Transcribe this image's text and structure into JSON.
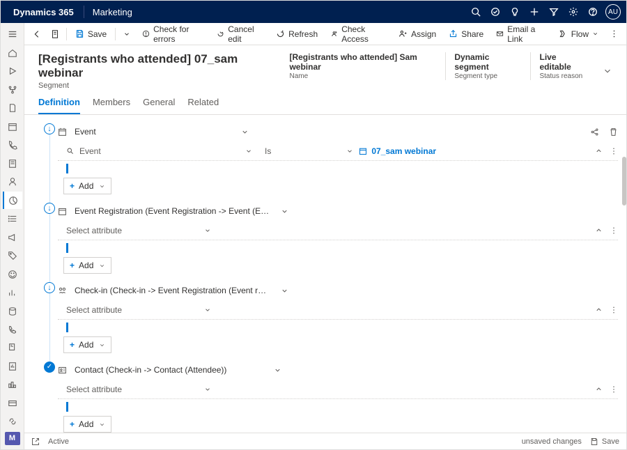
{
  "header": {
    "brand": "Dynamics 365",
    "module": "Marketing",
    "avatar": "AU"
  },
  "cmdbar": {
    "save": "Save",
    "check_errors": "Check for errors",
    "cancel_edit": "Cancel edit",
    "refresh": "Refresh",
    "check_access": "Check Access",
    "assign": "Assign",
    "share": "Share",
    "email_link": "Email a Link",
    "flow": "Flow"
  },
  "record": {
    "title": "[Registrants who attended] 07_sam webinar",
    "subtitle": "Segment",
    "meta": [
      {
        "value": "[Registrants who attended] Sam webinar",
        "label": "Name"
      },
      {
        "value": "Dynamic segment",
        "label": "Segment type"
      },
      {
        "value": "Live editable",
        "label": "Status reason"
      }
    ]
  },
  "tabs": [
    "Definition",
    "Members",
    "General",
    "Related"
  ],
  "blocks": [
    {
      "entity": "Event",
      "icon": "calendar",
      "attribute": "Event",
      "operator": "Is",
      "value": "07_sam webinar",
      "has_attr": true,
      "dot": "arrow"
    },
    {
      "entity": "Event Registration (Event Registration -> Event (Eve...",
      "icon": "calendar",
      "placeholder": "Select attribute",
      "has_attr": false,
      "dot": "arrow"
    },
    {
      "entity": "Check-in (Check-in -> Event Registration (Event reg...",
      "icon": "checkin",
      "placeholder": "Select attribute",
      "has_attr": false,
      "dot": "arrow"
    },
    {
      "entity": "Contact (Check-in -> Contact (Attendee))",
      "icon": "contact",
      "placeholder": "Select attribute",
      "has_attr": false,
      "dot": "check"
    }
  ],
  "add_label": "Add",
  "statusbar": {
    "state": "Active",
    "unsaved": "unsaved changes",
    "save": "Save"
  }
}
